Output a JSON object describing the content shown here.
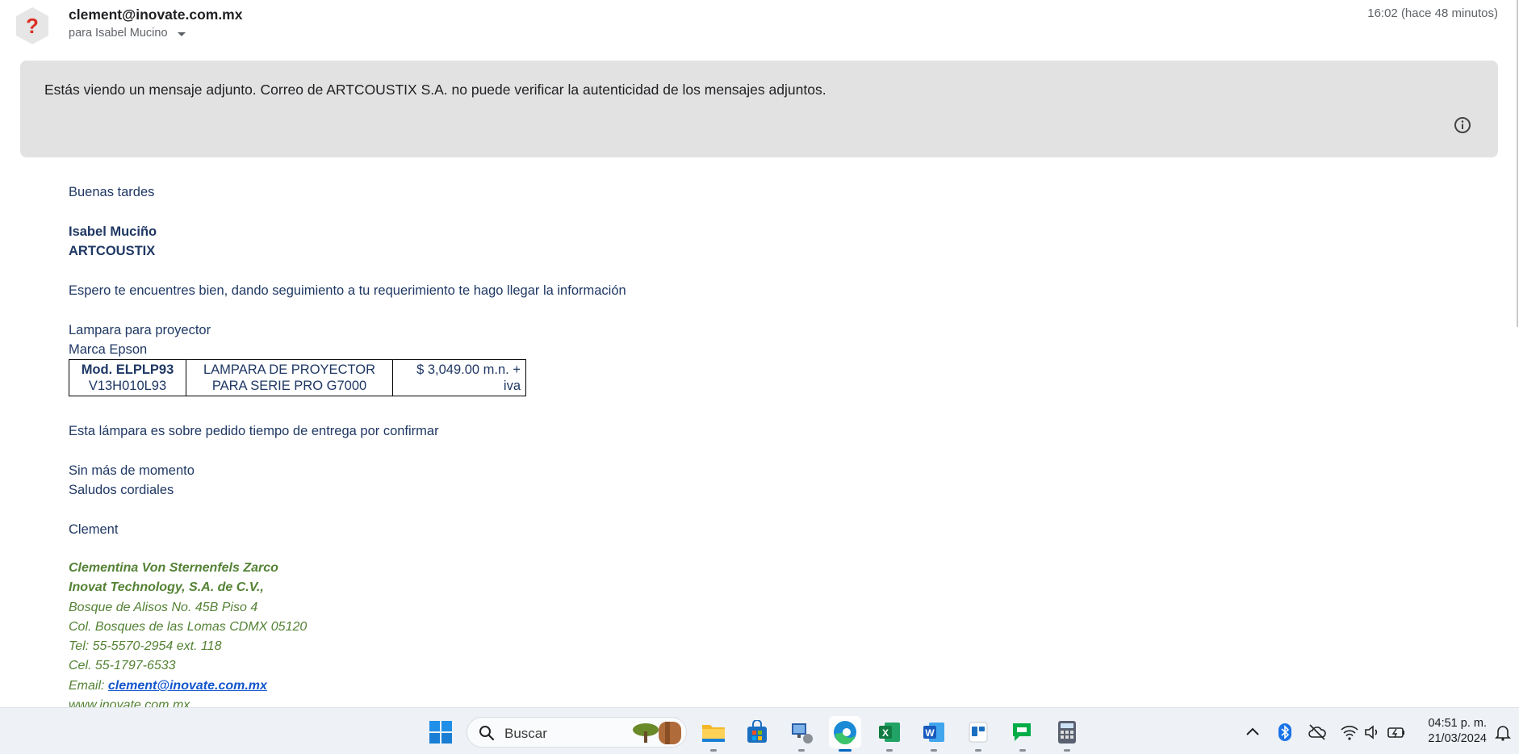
{
  "header": {
    "sender": "clement@inovate.com.mx",
    "recipient": "para Isabel Mucino",
    "timestamp": "16:02 (hace 48 minutos)"
  },
  "banner": {
    "text": "Estás viendo un mensaje adjunto. Correo de ARTCOUSTIX S.A. no puede verificar la autenticidad de los mensajes adjuntos."
  },
  "body": {
    "greeting": "Buenas tardes",
    "addressee_name": "Isabel Muciño",
    "addressee_company": "ARTCOUSTIX",
    "intro": "Espero te encuentres bien, dando seguimiento a tu requerimiento te hago llegar la información",
    "product_line1": "Lampara para proyector",
    "product_line2": "Marca Epson",
    "table": {
      "model_label": "Mod. ELPLP93",
      "model_code": "V13H010L93",
      "description_line1": "LAMPARA DE PROYECTOR",
      "description_line2": "PARA SERIE PRO G7000",
      "price_line1": "$ 3,049.00 m.n. +",
      "price_line2": "iva"
    },
    "delivery_note": "Esta lámpara es sobre pedido tiempo de entrega por confirmar",
    "closing1": "Sin más de momento",
    "closing2": "Saludos cordiales",
    "sign_name": "Clement"
  },
  "signature": {
    "full_name": "Clementina Von Sternenfels Zarco",
    "company": "Inovat Technology, S.A. de C.V.,",
    "address1": "Bosque de Alisos No. 45B Piso 4",
    "address2": "Col. Bosques de las Lomas CDMX 05120",
    "tel": "Tel: 55-5570-2954 ext. 118",
    "cel": "Cel. 55-1797-6533",
    "email_label": "Email: ",
    "email": "clement@inovate.com.mx",
    "web": "www.inovate.com.mx"
  },
  "taskbar": {
    "search_label": "Buscar",
    "apps": [
      "file-explorer",
      "microsoft-store",
      "network-app",
      "edge",
      "excel",
      "word",
      "todo-app",
      "google-chat",
      "calculator"
    ],
    "active_app": "edge",
    "time": "04:51 p. m.",
    "date": "21/03/2024"
  },
  "colors": {
    "body_text": "#1f3864",
    "signature_green": "#548235",
    "link_blue": "#1155cc",
    "banner_bg": "#e2e2e2",
    "taskbar_bg": "#eef1f6"
  }
}
